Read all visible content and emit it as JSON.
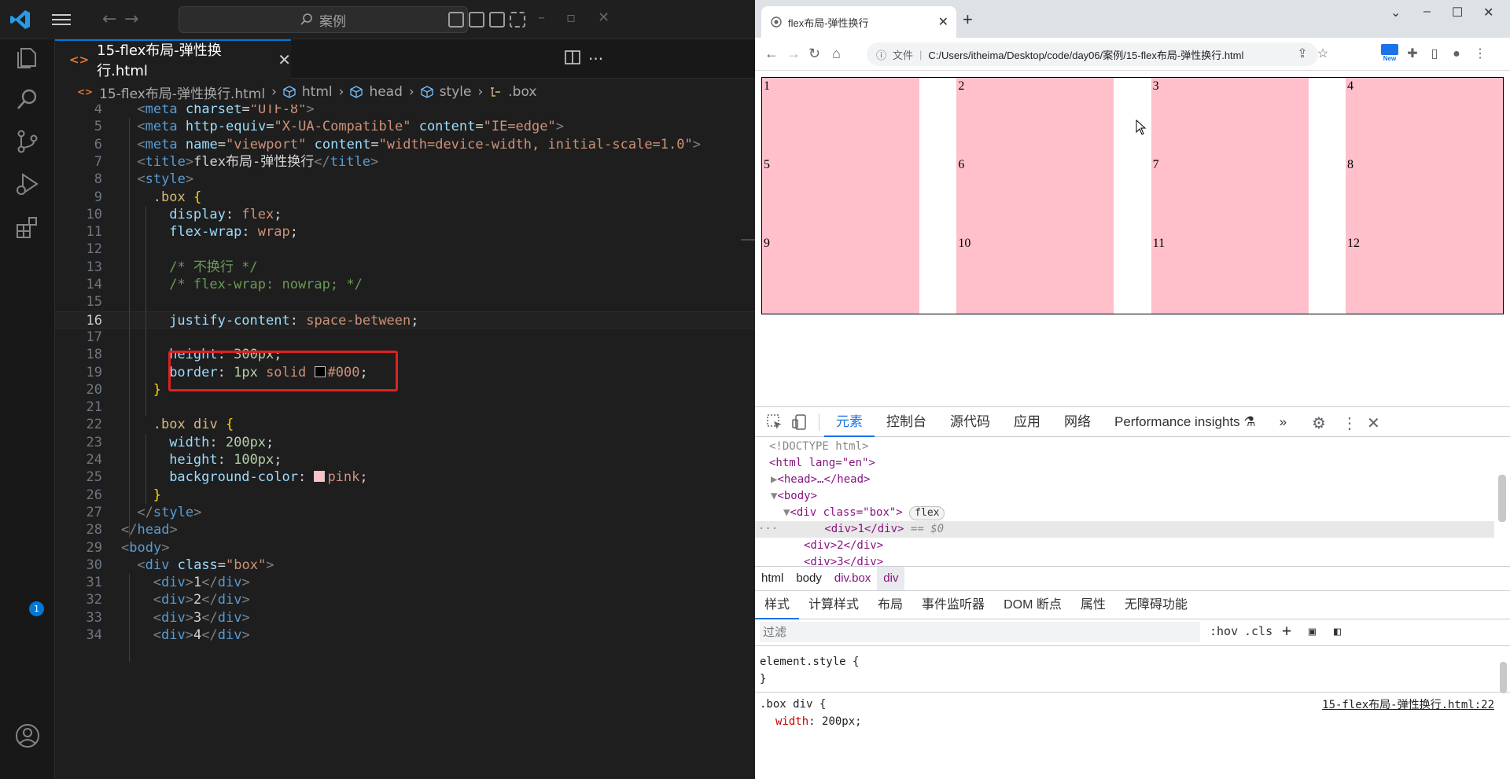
{
  "vscode": {
    "search_placeholder": "案例",
    "account_badge": "1",
    "tab": {
      "label": "15-flex布局-弹性换行.html",
      "icon": "html-file-icon"
    },
    "breadcrumb": [
      "15-flex布局-弹性换行.html",
      "html",
      "head",
      "style",
      ".box"
    ],
    "lines": [
      {
        "n": "4",
        "parts": [
          [
            "br",
            "<"
          ],
          [
            "tag",
            "meta"
          ],
          [
            "txt",
            " "
          ],
          [
            "attr",
            "charset"
          ],
          [
            "pun",
            "="
          ],
          [
            "str",
            "\"UTF-8\""
          ],
          [
            "br",
            ">"
          ]
        ]
      },
      {
        "n": "5",
        "parts": [
          [
            "br",
            "<"
          ],
          [
            "tag",
            "meta"
          ],
          [
            "txt",
            " "
          ],
          [
            "attr",
            "http-equiv"
          ],
          [
            "pun",
            "="
          ],
          [
            "str",
            "\"X-UA-Compatible\""
          ],
          [
            "txt",
            " "
          ],
          [
            "attr",
            "content"
          ],
          [
            "pun",
            "="
          ],
          [
            "str",
            "\"IE=edge\""
          ],
          [
            "br",
            ">"
          ]
        ]
      },
      {
        "n": "6",
        "parts": [
          [
            "br",
            "<"
          ],
          [
            "tag",
            "meta"
          ],
          [
            "txt",
            " "
          ],
          [
            "attr",
            "name"
          ],
          [
            "pun",
            "="
          ],
          [
            "str",
            "\"viewport\""
          ],
          [
            "txt",
            " "
          ],
          [
            "attr",
            "content"
          ],
          [
            "pun",
            "="
          ],
          [
            "str",
            "\"width=device-width, initial-scale=1.0\""
          ],
          [
            "br",
            ">"
          ]
        ]
      },
      {
        "n": "7",
        "parts": [
          [
            "br",
            "<"
          ],
          [
            "tag",
            "title"
          ],
          [
            "br",
            ">"
          ],
          [
            "txt",
            "flex布局-弹性换行"
          ],
          [
            "br",
            "</"
          ],
          [
            "tag",
            "title"
          ],
          [
            "br",
            ">"
          ]
        ]
      },
      {
        "n": "8",
        "parts": [
          [
            "br",
            "<"
          ],
          [
            "tag",
            "style"
          ],
          [
            "br",
            ">"
          ]
        ]
      },
      {
        "n": "9",
        "parts": [
          [
            "sel",
            ".box"
          ],
          [
            "txt",
            " "
          ],
          [
            "brace",
            "{"
          ]
        ]
      },
      {
        "n": "10",
        "parts": [
          [
            "prop",
            "display"
          ],
          [
            "pun",
            ": "
          ],
          [
            "val",
            "flex"
          ],
          [
            "pun",
            ";"
          ]
        ]
      },
      {
        "n": "11",
        "parts": [
          [
            "prop",
            "flex-wrap"
          ],
          [
            "pun",
            ": "
          ],
          [
            "val",
            "wrap"
          ],
          [
            "pun",
            ";"
          ]
        ]
      },
      {
        "n": "12",
        "parts": []
      },
      {
        "n": "13",
        "parts": [
          [
            "com",
            "/* 不换行 */"
          ]
        ]
      },
      {
        "n": "14",
        "parts": [
          [
            "com",
            "/* flex-wrap: nowrap; */"
          ]
        ]
      },
      {
        "n": "15",
        "parts": []
      },
      {
        "n": "16",
        "parts": [
          [
            "prop",
            "justify-content"
          ],
          [
            "pun",
            ": "
          ],
          [
            "val",
            "space-between"
          ],
          [
            "pun",
            ";"
          ]
        ]
      },
      {
        "n": "17",
        "parts": []
      },
      {
        "n": "18",
        "parts": [
          [
            "prop",
            "height"
          ],
          [
            "pun",
            ": "
          ],
          [
            "num",
            "300px"
          ],
          [
            "pun",
            ";"
          ]
        ]
      },
      {
        "n": "19",
        "parts": [
          [
            "prop",
            "border"
          ],
          [
            "pun",
            ": "
          ],
          [
            "num",
            "1px"
          ],
          [
            "txt",
            " "
          ],
          [
            "val",
            "solid"
          ],
          [
            "txt",
            " "
          ],
          [
            "swatch",
            "#000000"
          ],
          [
            "val",
            "#000"
          ],
          [
            "pun",
            ";"
          ]
        ]
      },
      {
        "n": "20",
        "parts": [
          [
            "brace",
            "}"
          ]
        ]
      },
      {
        "n": "21",
        "parts": []
      },
      {
        "n": "22",
        "parts": [
          [
            "sel",
            ".box div"
          ],
          [
            "txt",
            " "
          ],
          [
            "brace",
            "{"
          ]
        ]
      },
      {
        "n": "23",
        "parts": [
          [
            "prop",
            "width"
          ],
          [
            "pun",
            ": "
          ],
          [
            "num",
            "200px"
          ],
          [
            "pun",
            ";"
          ]
        ]
      },
      {
        "n": "24",
        "parts": [
          [
            "prop",
            "height"
          ],
          [
            "pun",
            ": "
          ],
          [
            "num",
            "100px"
          ],
          [
            "pun",
            ";"
          ]
        ]
      },
      {
        "n": "25",
        "parts": [
          [
            "prop",
            "background-color"
          ],
          [
            "pun",
            ": "
          ],
          [
            "swatch",
            "#ffc0cb"
          ],
          [
            "val",
            "pink"
          ],
          [
            "pun",
            ";"
          ]
        ]
      },
      {
        "n": "26",
        "parts": [
          [
            "brace",
            "}"
          ]
        ]
      },
      {
        "n": "27",
        "parts": [
          [
            "br",
            "</"
          ],
          [
            "tag",
            "style"
          ],
          [
            "br",
            ">"
          ]
        ]
      },
      {
        "n": "28",
        "parts": [
          [
            "br",
            "</"
          ],
          [
            "tag",
            "head"
          ],
          [
            "br",
            ">"
          ]
        ]
      },
      {
        "n": "29",
        "parts": [
          [
            "br",
            "<"
          ],
          [
            "tag",
            "body"
          ],
          [
            "br",
            ">"
          ]
        ]
      },
      {
        "n": "30",
        "parts": [
          [
            "br",
            "<"
          ],
          [
            "tag",
            "div"
          ],
          [
            "txt",
            " "
          ],
          [
            "attr",
            "class"
          ],
          [
            "pun",
            "="
          ],
          [
            "str",
            "\"box\""
          ],
          [
            "br",
            ">"
          ]
        ]
      },
      {
        "n": "31",
        "parts": [
          [
            "br",
            "<"
          ],
          [
            "tag",
            "div"
          ],
          [
            "br",
            ">"
          ],
          [
            "txt",
            "1"
          ],
          [
            "br",
            "</"
          ],
          [
            "tag",
            "div"
          ],
          [
            "br",
            ">"
          ]
        ]
      },
      {
        "n": "32",
        "parts": [
          [
            "br",
            "<"
          ],
          [
            "tag",
            "div"
          ],
          [
            "br",
            ">"
          ],
          [
            "txt",
            "2"
          ],
          [
            "br",
            "</"
          ],
          [
            "tag",
            "div"
          ],
          [
            "br",
            ">"
          ]
        ]
      },
      {
        "n": "33",
        "parts": [
          [
            "br",
            "<"
          ],
          [
            "tag",
            "div"
          ],
          [
            "br",
            ">"
          ],
          [
            "txt",
            "3"
          ],
          [
            "br",
            "</"
          ],
          [
            "tag",
            "div"
          ],
          [
            "br",
            ">"
          ]
        ]
      },
      {
        "n": "34",
        "parts": [
          [
            "br",
            "<"
          ],
          [
            "tag",
            "div"
          ],
          [
            "br",
            ">"
          ],
          [
            "txt",
            "4"
          ],
          [
            "br",
            "</"
          ],
          [
            "tag",
            "div"
          ],
          [
            "br",
            ">"
          ]
        ]
      }
    ]
  },
  "browser": {
    "tab_title": "flex布局-弹性换行",
    "address_label": "文件",
    "address_url": "C:/Users/itheima/Desktop/code/day06/案例/15-flex布局-弹性换行.html",
    "new_badge": "New",
    "flex_items": [
      "1",
      "2",
      "3",
      "4",
      "5",
      "6",
      "7",
      "8",
      "9",
      "10",
      "11",
      "12"
    ],
    "item_color": "#ffc0cb"
  },
  "devtools": {
    "tabs": [
      "元素",
      "控制台",
      "源代码",
      "应用",
      "网络",
      "Performance insights"
    ],
    "more": "»",
    "dom": {
      "doctype": "<!DOCTYPE html>",
      "html_open": "<html lang=\"en\">",
      "head": "<head>…</head>",
      "body": "<body>",
      "div_box": "<div class=\"box\">",
      "flex_badge": "flex",
      "div1": "<div>1</div>",
      "div1_ref": "== $0",
      "div2": "<div>2</div>",
      "div3": "<div>3</div>",
      "dots": "···"
    },
    "crumbs": [
      "html",
      "body",
      "div.box",
      "div"
    ],
    "style_tabs": [
      "样式",
      "计算样式",
      "布局",
      "事件监听器",
      "DOM 断点",
      "属性",
      "无障碍功能"
    ],
    "filter_placeholder": "过滤",
    "hov": ":hov",
    "cls": ".cls",
    "styles": {
      "element_style": "element.style {",
      "close": "}",
      "rule_selector": ".box div {",
      "rule_source": "15-flex布局-弹性换行.html:22",
      "rule_width": "width: 200px;"
    }
  }
}
